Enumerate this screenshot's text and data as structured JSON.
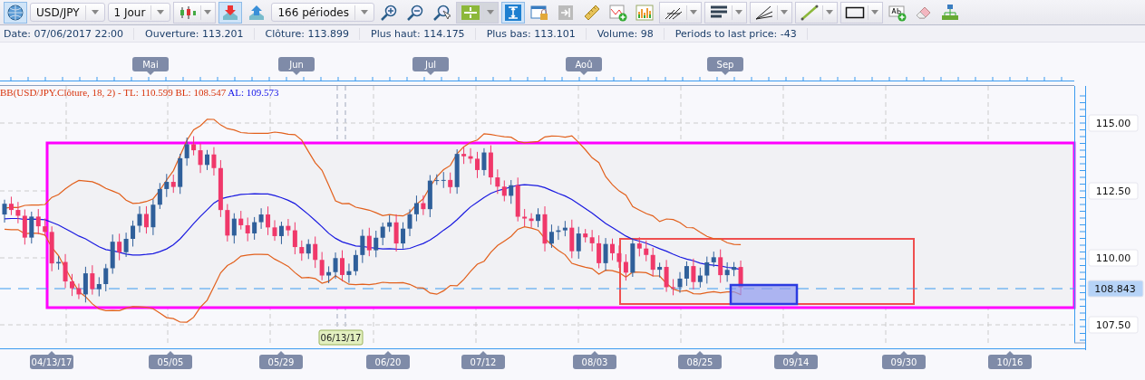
{
  "toolbar": {
    "items": [
      {
        "kind": "globe",
        "active": true
      },
      {
        "kind": "dropdown",
        "value": "USD/JPY"
      },
      {
        "kind": "dropdown",
        "value": "1 Jour"
      },
      {
        "kind": "candle-menu",
        "active": false
      },
      {
        "kind": "download",
        "active": true
      },
      {
        "kind": "upload",
        "active": false
      },
      {
        "kind": "dropdown",
        "value": "166 périodes"
      },
      {
        "kind": "zoom-in",
        "active": false
      },
      {
        "kind": "zoom-out",
        "active": false
      },
      {
        "kind": "zoom-reset",
        "active": false
      },
      {
        "kind": "fit-menu",
        "active": true
      },
      {
        "kind": "scale",
        "active": true
      },
      {
        "kind": "lock-window",
        "active": false
      },
      {
        "kind": "arrow-end",
        "active": false
      },
      {
        "kind": "ruler",
        "active": false
      },
      {
        "kind": "add-indicator",
        "active": false
      },
      {
        "kind": "bars",
        "active": false
      },
      {
        "kind": "pitchfork-menu",
        "active": false
      },
      {
        "kind": "fibonacci-menu",
        "active": false
      },
      {
        "kind": "fan-menu",
        "active": false
      },
      {
        "kind": "line-menu",
        "active": false
      },
      {
        "kind": "rectangle-menu",
        "active": false
      },
      {
        "kind": "add-text",
        "active": false
      },
      {
        "kind": "eraser",
        "active": false
      },
      {
        "kind": "hierarchy",
        "active": false
      }
    ]
  },
  "info_bar": [
    "Date: 07/06/2017 22:00",
    "Ouverture: 113.201",
    "Clôture: 113.899",
    "Plus haut: 114.175",
    "Plus bas: 113.101",
    "Volume: 98",
    "Periods to last price: -43"
  ],
  "chart": {
    "month_tags": [
      "Mai",
      "Jun",
      "Jul",
      "Aoû",
      "Sep"
    ],
    "legend": {
      "bands": "BB(USD/JPY.Clôture, 18, 2) - TL: 110.599 BL: 108.547",
      "average": "AL: 109.573"
    },
    "price_labels": [
      {
        "label": "115.00",
        "kind": "tick"
      },
      {
        "label": "112.50",
        "kind": "tick"
      },
      {
        "label": "110.00",
        "kind": "tick"
      },
      {
        "label": "108.843",
        "kind": "current"
      },
      {
        "label": "107.50",
        "kind": "tick"
      }
    ],
    "date_labels": [
      "04/13/17",
      "05/05",
      "05/29",
      "06/20",
      "07/12",
      "08/03",
      "08/25",
      "09/14",
      "09/30",
      "10/16"
    ],
    "cursor_date": "06/13/17"
  }
}
